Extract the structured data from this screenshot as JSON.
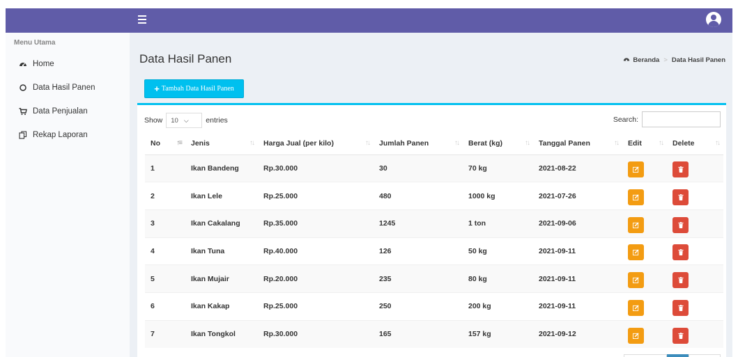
{
  "topbar": {
    "color": "#605ca8",
    "menu_icon": "hamburger-icon",
    "user_icon": "user-circle-icon"
  },
  "sidebar": {
    "header": "Menu Utama",
    "items": [
      {
        "label": "Home",
        "icon": "dashboard-icon"
      },
      {
        "label": "Data Hasil Panen",
        "icon": "circle-outline-icon"
      },
      {
        "label": "Data Penjualan",
        "icon": "cart-icon"
      },
      {
        "label": "Rekap Laporan",
        "icon": "copy-icon"
      }
    ]
  },
  "main": {
    "title": "Data Hasil Panen",
    "breadcrumb": {
      "home": "Beranda",
      "current": "Data Hasil Panen"
    },
    "add_button": "Tambah Data Hasil Panen",
    "show_label": "Show",
    "entries_value": "10",
    "entries_label": "entries",
    "search_label": "Search:",
    "search_value": ""
  },
  "table": {
    "headers": [
      "No",
      "Jenis",
      "Harga Jual (per kilo)",
      "Jumlah Panen",
      "Berat (kg)",
      "Tanggal Panen",
      "Edit",
      "Delete"
    ],
    "rows": [
      [
        "1",
        "Ikan Bandeng",
        "Rp.30.000",
        "30",
        "70 kg",
        "2021-08-22"
      ],
      [
        "2",
        "Ikan Lele",
        "Rp.25.000",
        "480",
        "1000 kg",
        "2021-07-26"
      ],
      [
        "3",
        "Ikan Cakalang",
        "Rp.35.000",
        "1245",
        "1 ton",
        "2021-09-06"
      ],
      [
        "4",
        "Ikan Tuna",
        "Rp.40.000",
        "126",
        "50 kg",
        "2021-09-11"
      ],
      [
        "5",
        "Ikan Mujair",
        "Rp.20.000",
        "235",
        "80 kg",
        "2021-09-11"
      ],
      [
        "6",
        "Ikan Kakap",
        "Rp.25.000",
        "250",
        "200 kg",
        "2021-09-11"
      ],
      [
        "7",
        "Ikan Tongkol",
        "Rp.30.000",
        "165",
        "157 kg",
        "2021-09-12"
      ]
    ],
    "edit_icon": "edit-icon",
    "delete_icon": "trash-icon"
  },
  "colors": {
    "accent": "#00c0ef",
    "edit": "#f39c12",
    "delete": "#dd4b39",
    "page_active": "#3c8dbc"
  }
}
